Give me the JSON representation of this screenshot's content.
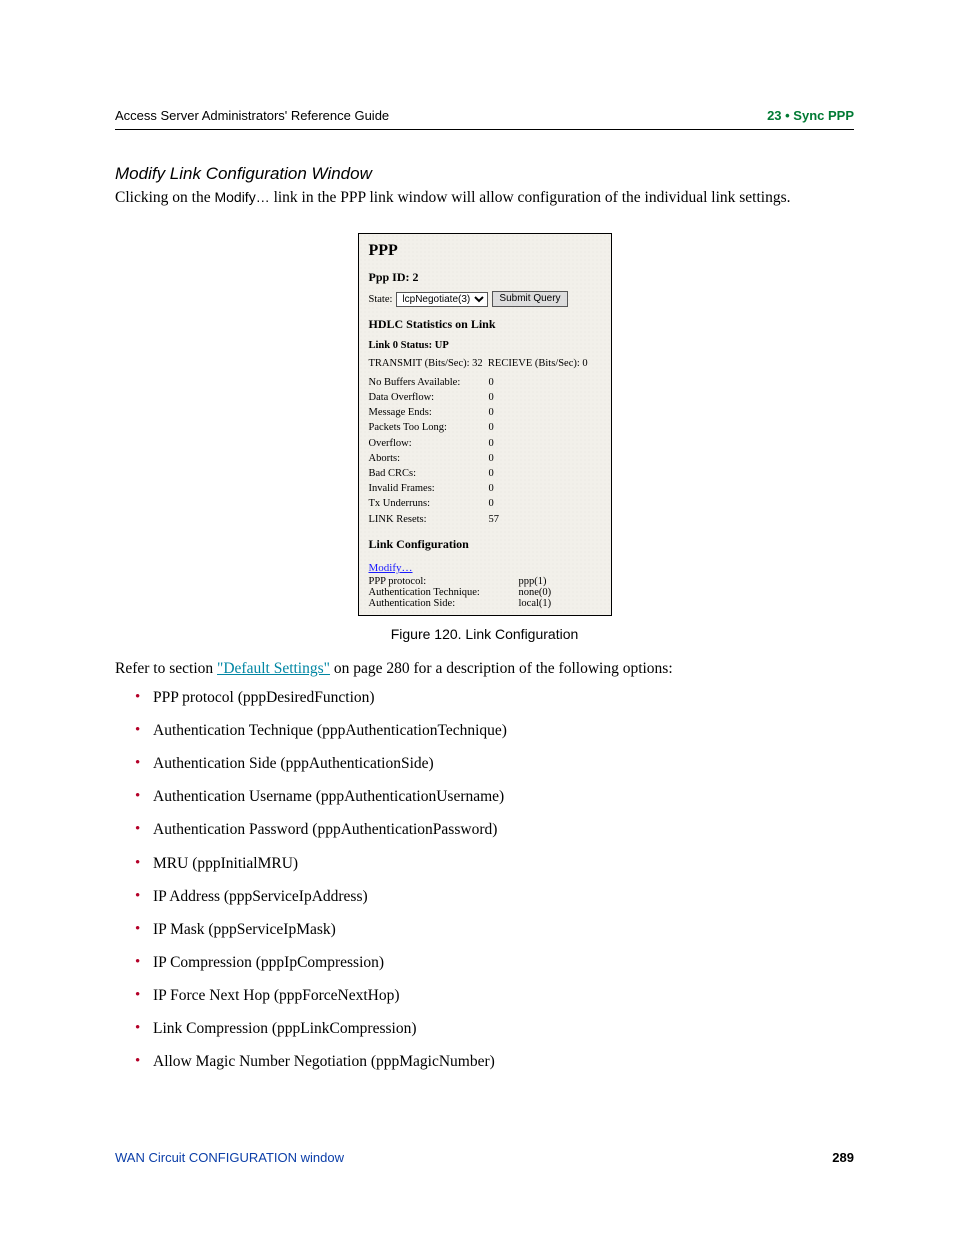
{
  "header": {
    "left": "Access Server Administrators' Reference Guide",
    "right": "23 • Sync PPP"
  },
  "section": {
    "title": "Modify Link Configuration Window",
    "intro_pre": "Clicking on the ",
    "intro_sans": "Modify…",
    "intro_post": " link in the PPP link window will allow configuration of the individual link settings."
  },
  "figure": {
    "title": "PPP",
    "ppp_id_label": "Ppp ID: 2",
    "state_label": "State:",
    "state_value": "lcpNegotiate(3)",
    "submit_label": "Submit Query",
    "hdlc_heading": "HDLC Statistics on Link",
    "link_status": "Link 0 Status: UP",
    "tx_label": "TRANSMIT (Bits/Sec):",
    "tx_val": "32",
    "rx_label": "RECIEVE (Bits/Sec):",
    "rx_val": "0",
    "stats": [
      {
        "label": "No Buffers Available:",
        "value": "0"
      },
      {
        "label": "Data Overflow:",
        "value": "0"
      },
      {
        "label": "Message Ends:",
        "value": "0"
      },
      {
        "label": "Packets Too Long:",
        "value": "0"
      },
      {
        "label": "Overflow:",
        "value": "0"
      },
      {
        "label": "Aborts:",
        "value": "0"
      },
      {
        "label": "Bad CRCs:",
        "value": "0"
      },
      {
        "label": "Invalid Frames:",
        "value": "0"
      },
      {
        "label": "Tx Underruns:",
        "value": "0"
      },
      {
        "label": "LINK Resets:",
        "value": "57"
      }
    ],
    "link_conf_heading": "Link Configuration",
    "modify_link": "Modify…",
    "conf": [
      {
        "label": "PPP protocol:",
        "value": "ppp(1)"
      },
      {
        "label": "Authentication Technique:",
        "value": "none(0)"
      },
      {
        "label": "Authentication Side:",
        "value": "local(1)"
      }
    ],
    "caption": "Figure 120. Link Configuration"
  },
  "refer": {
    "pre": "Refer to section ",
    "link": "\"Default Settings\"",
    "post": " on page 280 for a description of the following options:"
  },
  "options": [
    "PPP protocol (pppDesiredFunction)",
    "Authentication Technique (pppAuthenticationTechnique)",
    "Authentication Side (pppAuthenticationSide)",
    "Authentication Username (pppAuthenticationUsername)",
    "Authentication Password (pppAuthenticationPassword)",
    "MRU (pppInitialMRU)",
    "IP Address (pppServiceIpAddress)",
    "IP Mask (pppServiceIpMask)",
    "IP Compression (pppIpCompression)",
    "IP Force Next Hop (pppForceNextHop)",
    "Link Compression (pppLinkCompression)",
    "Allow Magic Number Negotiation (pppMagicNumber)"
  ],
  "footer": {
    "left": "WAN Circuit CONFIGURATION window",
    "right": "289"
  }
}
